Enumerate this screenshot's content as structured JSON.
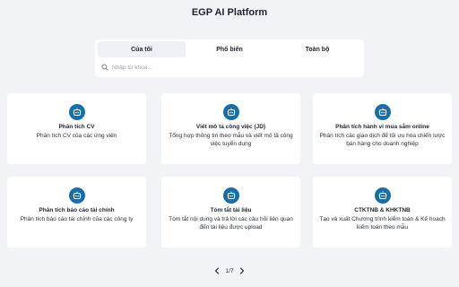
{
  "app": {
    "title": "EGP AI Platform"
  },
  "tabs": [
    {
      "label": "Của tôi",
      "active": true
    },
    {
      "label": "Phổ biến",
      "active": false
    },
    {
      "label": "Toàn bộ",
      "active": false
    }
  ],
  "search": {
    "placeholder": "Nhập từ khoá...",
    "value": ""
  },
  "icons": {
    "search": "search-icon",
    "card": "robot-icon",
    "prev": "chevron-left-icon",
    "next": "chevron-right-icon"
  },
  "colors": {
    "accent": "#1a6ea8",
    "background": "#f2f3f6",
    "card": "#ffffff"
  },
  "cards": [
    {
      "title": "Phân tích CV",
      "desc": "Phân tích CV của các ứng viên"
    },
    {
      "title": "Viết mô tả công việc (JD)",
      "desc": "Tổng hợp thông tin theo mẫu và viết mô tả công việc tuyển dụng"
    },
    {
      "title": "Phân tích hành vi mua sắm online",
      "desc": "Phân tích các giao dịch để tối ưu hóa chiến lược bán hàng cho doanh nghiệp"
    },
    {
      "title": "Phân tích báo cáo tài chính",
      "desc": "Phân tích báo cáo tài chính của các công ty"
    },
    {
      "title": "Tóm tắt tài liệu",
      "desc": "Tóm tắt nội dung và trả lời các câu hỏi liên quan đến tài liệu được upload"
    },
    {
      "title": "CTKTNB & KHKTNB",
      "desc": "Tạo và xuất Chương trình kiểm toán & Kế hoạch kiểm toán theo mẫu"
    }
  ],
  "pagination": {
    "label": "1/7"
  }
}
